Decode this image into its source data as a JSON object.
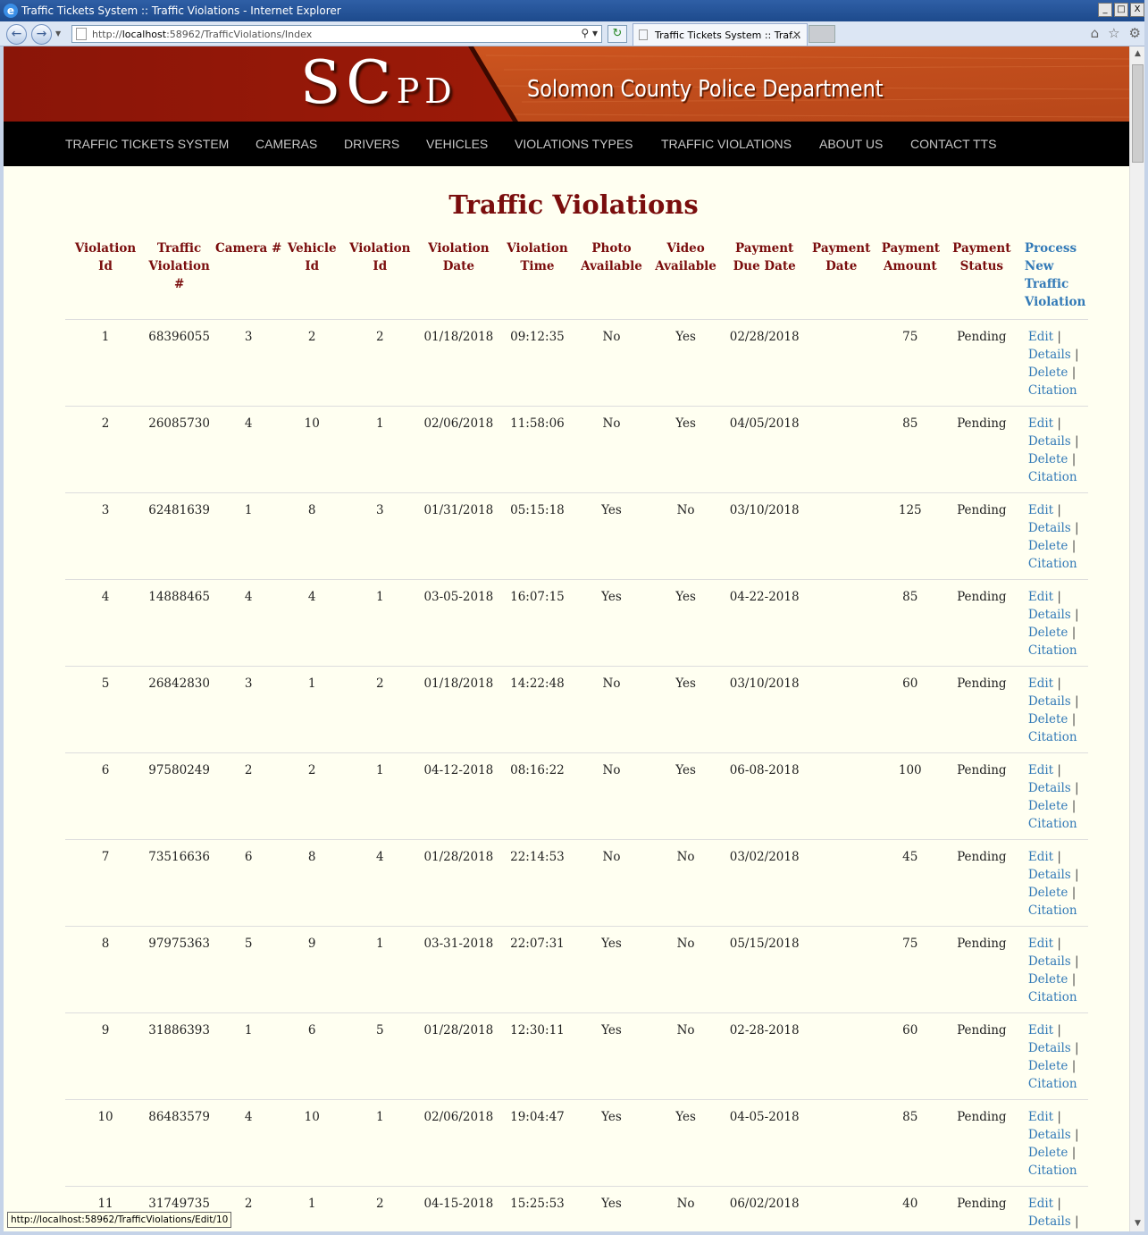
{
  "window": {
    "title": "Traffic Tickets System :: Traffic Violations - Internet Explorer",
    "minimize": "_",
    "maximize": "□",
    "close": "X"
  },
  "browser": {
    "address_prefix": "http://",
    "address_host": "localhost",
    "address_rest": ":58962/TrafficViolations/Index",
    "tab_title": "Traffic Tickets System :: Traf...",
    "tab_close": "✕",
    "status_url": "http://localhost:58962/TrafficViolations/Edit/10"
  },
  "banner": {
    "logo_s": "S",
    "logo_c": "C",
    "logo_pd": "PD",
    "department": "Solomon County Police Department"
  },
  "nav": {
    "items": [
      "TRAFFIC TICKETS SYSTEM",
      "CAMERAS",
      "DRIVERS",
      "VEHICLES",
      "VIOLATIONS TYPES",
      "TRAFFIC VIOLATIONS",
      "ABOUT US",
      "CONTACT TTS"
    ]
  },
  "page": {
    "title": "Traffic Violations"
  },
  "table": {
    "headers": [
      "Violation Id",
      "Traffic Violation #",
      "Camera #",
      "Vehicle Id",
      "Violation Id",
      "Violation Date",
      "Violation Time",
      "Photo Available",
      "Video Available",
      "Payment Due Date",
      "Payment Date",
      "Payment Amount",
      "Payment Status"
    ],
    "process_link": "Process New Traffic Violation",
    "action_labels": {
      "edit": "Edit",
      "details": "Details",
      "delete": "Delete",
      "citation": "Citation",
      "separator": "|"
    },
    "rows": [
      [
        "1",
        "68396055",
        "3",
        "2",
        "2",
        "01/18/2018",
        "09:12:35",
        "No",
        "Yes",
        "02/28/2018",
        "",
        "75",
        "Pending"
      ],
      [
        "2",
        "26085730",
        "4",
        "10",
        "1",
        "02/06/2018",
        "11:58:06",
        "No",
        "Yes",
        "04/05/2018",
        "",
        "85",
        "Pending"
      ],
      [
        "3",
        "62481639",
        "1",
        "8",
        "3",
        "01/31/2018",
        "05:15:18",
        "Yes",
        "No",
        "03/10/2018",
        "",
        "125",
        "Pending"
      ],
      [
        "4",
        "14888465",
        "4",
        "4",
        "1",
        "03-05-2018",
        "16:07:15",
        "Yes",
        "Yes",
        "04-22-2018",
        "",
        "85",
        "Pending"
      ],
      [
        "5",
        "26842830",
        "3",
        "1",
        "2",
        "01/18/2018",
        "14:22:48",
        "No",
        "Yes",
        "03/10/2018",
        "",
        "60",
        "Pending"
      ],
      [
        "6",
        "97580249",
        "2",
        "2",
        "1",
        "04-12-2018",
        "08:16:22",
        "No",
        "Yes",
        "06-08-2018",
        "",
        "100",
        "Pending"
      ],
      [
        "7",
        "73516636",
        "6",
        "8",
        "4",
        "01/28/2018",
        "22:14:53",
        "No",
        "No",
        "03/02/2018",
        "",
        "45",
        "Pending"
      ],
      [
        "8",
        "97975363",
        "5",
        "9",
        "1",
        "03-31-2018",
        "22:07:31",
        "Yes",
        "No",
        "05/15/2018",
        "",
        "75",
        "Pending"
      ],
      [
        "9",
        "31886393",
        "1",
        "6",
        "5",
        "01/28/2018",
        "12:30:11",
        "Yes",
        "No",
        "02-28-2018",
        "",
        "60",
        "Pending"
      ],
      [
        "10",
        "86483579",
        "4",
        "10",
        "1",
        "02/06/2018",
        "19:04:47",
        "Yes",
        "Yes",
        "04-05-2018",
        "",
        "85",
        "Pending"
      ],
      [
        "11",
        "31749735",
        "2",
        "1",
        "2",
        "04-15-2018",
        "15:25:53",
        "Yes",
        "No",
        "06/02/2018",
        "",
        "40",
        "Pending"
      ]
    ]
  },
  "colors": {
    "header_text": "#7a0d0d",
    "link": "#337ab7",
    "page_bg": "#fffff1",
    "nav_bg": "#000000",
    "banner_dark": "#8b1608",
    "banner_light": "#c9521e"
  }
}
